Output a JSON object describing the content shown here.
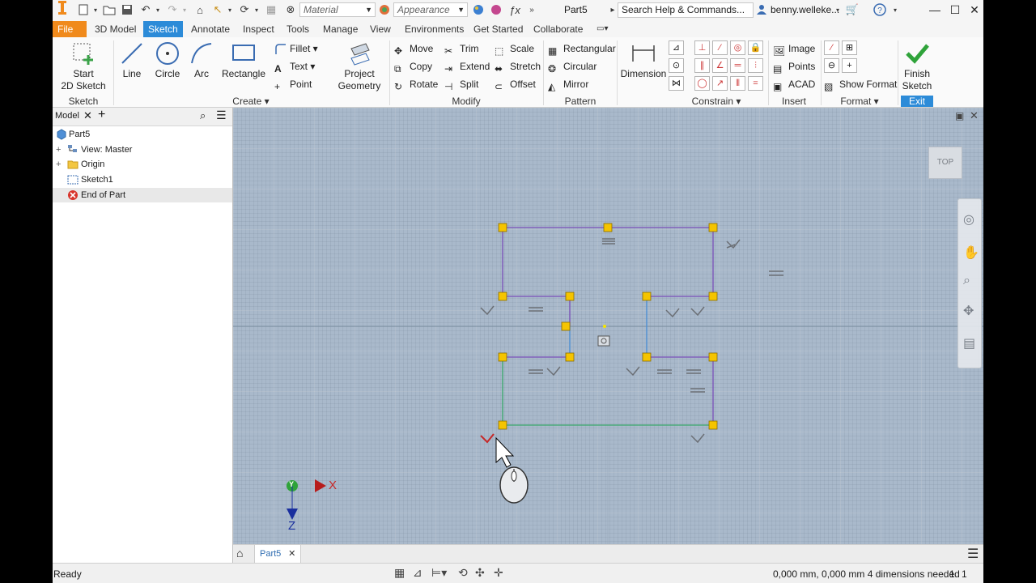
{
  "quick_access": {
    "material": "Material",
    "appearance": "Appearance",
    "doc_title": "Part5",
    "search_placeholder": "Search Help & Commands...",
    "user": "benny.welleke..."
  },
  "tabs": [
    "File",
    "3D Model",
    "Sketch",
    "Annotate",
    "Inspect",
    "Tools",
    "Manage",
    "View",
    "Environments",
    "Get Started",
    "Collaborate"
  ],
  "ribbon": {
    "sketch_group": {
      "label": "Sketch",
      "start_line1": "Start",
      "start_line2": "2D Sketch"
    },
    "create_group": {
      "label": "Create",
      "line": "Line",
      "circle": "Circle",
      "arc": "Arc",
      "rectangle": "Rectangle",
      "fillet": "Fillet",
      "text": "Text",
      "point": "Point",
      "project_line1": "Project",
      "project_line2": "Geometry"
    },
    "modify_group": {
      "label": "Modify",
      "move": "Move",
      "copy": "Copy",
      "rotate": "Rotate",
      "trim": "Trim",
      "extend": "Extend",
      "split": "Split",
      "scale": "Scale",
      "stretch": "Stretch",
      "offset": "Offset"
    },
    "pattern_group": {
      "label": "Pattern",
      "rectangular": "Rectangular",
      "circular": "Circular",
      "mirror": "Mirror"
    },
    "dimension": "Dimension",
    "constrain_group": {
      "label": "Constrain"
    },
    "insert_group": {
      "label": "Insert",
      "image": "Image",
      "points": "Points",
      "acad": "ACAD"
    },
    "format_group": {
      "label": "Format",
      "show_format": "Show Format"
    },
    "exit_group": {
      "label": "Exit",
      "finish_line1": "Finish",
      "finish_line2": "Sketch"
    }
  },
  "browser": {
    "tab": "Model",
    "items": [
      {
        "label": "Part5"
      },
      {
        "label": "View: Master"
      },
      {
        "label": "Origin"
      },
      {
        "label": "Sketch1"
      },
      {
        "label": "End of Part"
      }
    ]
  },
  "viewport": {
    "viewcube": "TOP",
    "axis_x": "X",
    "axis_y": "Y",
    "axis_z": "Z"
  },
  "doc_tabs": [
    "Part5"
  ],
  "status": {
    "left": "Ready",
    "coords": "0,000 mm, 0,000 mm 4 dimensions needed",
    "n1": "1",
    "n2": "1"
  },
  "colors": {
    "file_tab": "#f08a1c",
    "active_tab": "#2c8bd8",
    "sketch_line": "#7a4fb8",
    "sketch_line_green": "#3aa86b",
    "sketch_line_blue": "#4a8fd6",
    "point": "#f5c400"
  }
}
